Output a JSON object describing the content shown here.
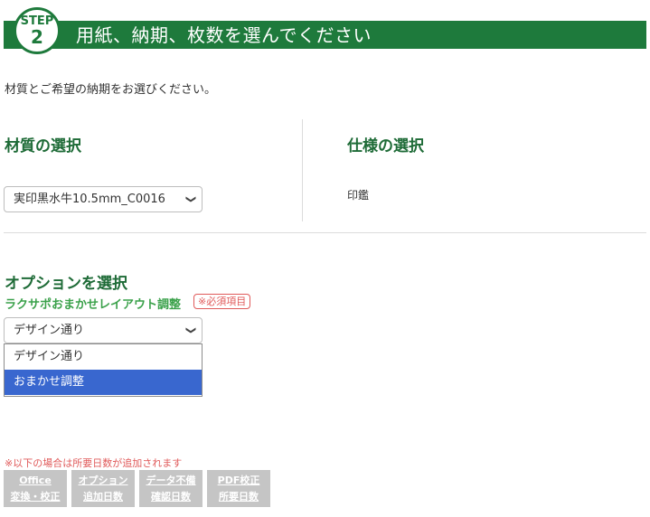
{
  "step": {
    "label": "STEP",
    "number": "2",
    "title": "用紙、納期、枚数を選んでください"
  },
  "intro": "材質とご希望の納期をお選びください。",
  "material": {
    "heading": "材質の選択",
    "selected": "実印黒水牛10.5mm_C0016"
  },
  "spec": {
    "heading": "仕様の選択",
    "value": "印鑑"
  },
  "options": {
    "heading": "オプションを選択",
    "layout_label": "ラクサポおまかせレイアウト調整",
    "required": "※必須項目",
    "selected": "デザイン通り",
    "items": [
      "デザイン通り",
      "おまかせ調整"
    ],
    "highlighted": "おまかせ調整"
  },
  "note": "※以下の場合は所要日数が追加されます",
  "buttons": [
    {
      "line1": "Office",
      "line2": "変換・校正"
    },
    {
      "line1": "オプション",
      "line2": "追加日数"
    },
    {
      "line1": "データ不備",
      "line2": "確認日数"
    },
    {
      "line1": "PDF校正",
      "line2": "所要日数"
    }
  ],
  "colors": {
    "accent": "#1e7a3c",
    "heading": "#1e6b37",
    "option_label": "#3aa14a",
    "warning": "#e05a5a",
    "highlight": "#3967cf",
    "button_gray": "#c5c5c5"
  },
  "icons": {
    "select_arrow": "chevron-down-icon"
  }
}
